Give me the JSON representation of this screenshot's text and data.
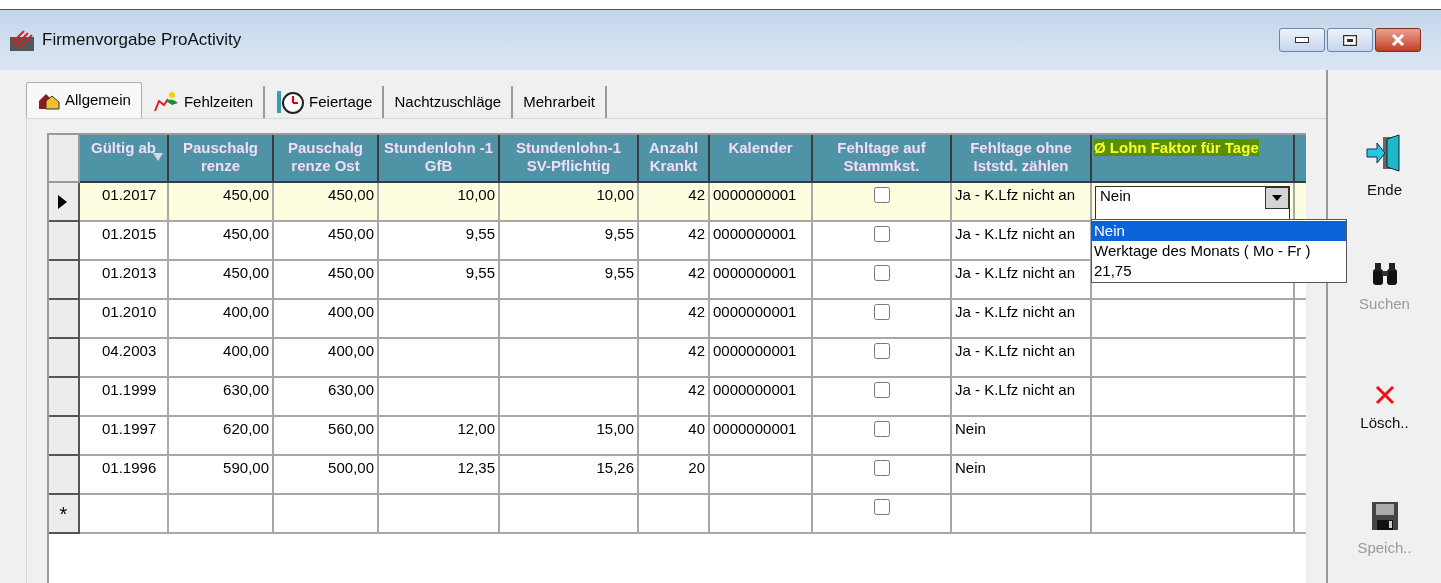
{
  "window": {
    "title": "Firmenvorgabe ProActivity"
  },
  "tabs": [
    {
      "label": "Allgemein",
      "selected": true
    },
    {
      "label": "Fehlzeiten",
      "selected": false
    },
    {
      "label": "Feiertage",
      "selected": false
    },
    {
      "label": "Nachtzuschläge",
      "selected": false
    },
    {
      "label": "Mehrarbeit",
      "selected": false
    }
  ],
  "grid": {
    "columns": [
      {
        "label": "Gültig ab",
        "sorted": true,
        "highlighted": false
      },
      {
        "label": "Pauschalg renze",
        "sorted": false,
        "highlighted": false
      },
      {
        "label": "Pauschalg renze Ost",
        "sorted": false,
        "highlighted": false
      },
      {
        "label": "Stundenlohn -1 GfB",
        "sorted": false,
        "highlighted": false
      },
      {
        "label": "Stundenlohn-1 SV-Pflichtig",
        "sorted": false,
        "highlighted": false
      },
      {
        "label": "Anzahl Krankt",
        "sorted": false,
        "highlighted": false
      },
      {
        "label": "Kalender",
        "sorted": false,
        "highlighted": false
      },
      {
        "label": "Fehltage auf Stammkst.",
        "sorted": false,
        "highlighted": false
      },
      {
        "label": "Fehltage ohne Iststd. zählen",
        "sorted": false,
        "highlighted": false
      },
      {
        "label": "Ø Lohn Faktor für Tage",
        "sorted": false,
        "highlighted": true
      }
    ],
    "rows": [
      {
        "current": true,
        "values": {
          "gueltig_ab": "01.2017",
          "pauschalgrenze": "450,00",
          "pauschalgrenze_ost": "450,00",
          "stundenlohn_gfb": "10,00",
          "stundenlohn_sv": "10,00",
          "anzahl_krankt": "42",
          "kalender": "0000000001"
        },
        "checked": false,
        "fehltage": "Ja - K.Lfz nicht an",
        "editor": {
          "value": "Nein",
          "expanded": true,
          "options": [
            {
              "label": "Nein",
              "selected": true
            },
            {
              "label": "Werktage des Monats ( Mo - Fr )",
              "selected": false
            },
            {
              "label": "21,75",
              "selected": false
            }
          ]
        }
      },
      {
        "current": false,
        "values": {
          "gueltig_ab": "01.2015",
          "pauschalgrenze": "450,00",
          "pauschalgrenze_ost": "450,00",
          "stundenlohn_gfb": "9,55",
          "stundenlohn_sv": "9,55",
          "anzahl_krankt": "42",
          "kalender": "0000000001"
        },
        "checked": false,
        "fehltage": "Ja - K.Lfz nicht an"
      },
      {
        "current": false,
        "values": {
          "gueltig_ab": "01.2013",
          "pauschalgrenze": "450,00",
          "pauschalgrenze_ost": "450,00",
          "stundenlohn_gfb": "9,55",
          "stundenlohn_sv": "9,55",
          "anzahl_krankt": "42",
          "kalender": "0000000001"
        },
        "checked": false,
        "fehltage": "Ja - K.Lfz nicht an"
      },
      {
        "current": false,
        "values": {
          "gueltig_ab": "01.2010",
          "pauschalgrenze": "400,00",
          "pauschalgrenze_ost": "400,00",
          "anzahl_krankt": "42",
          "kalender": "0000000001"
        },
        "checked": false,
        "fehltage": "Ja - K.Lfz nicht an"
      },
      {
        "current": false,
        "values": {
          "gueltig_ab": "04.2003",
          "pauschalgrenze": "400,00",
          "pauschalgrenze_ost": "400,00",
          "anzahl_krankt": "42",
          "kalender": "0000000001"
        },
        "checked": false,
        "fehltage": "Ja - K.Lfz nicht an"
      },
      {
        "current": false,
        "values": {
          "gueltig_ab": "01.1999",
          "pauschalgrenze": "630,00",
          "pauschalgrenze_ost": "630,00",
          "anzahl_krankt": "42",
          "kalender": "0000000001"
        },
        "checked": false,
        "fehltage": "Ja - K.Lfz nicht an"
      },
      {
        "current": false,
        "values": {
          "gueltig_ab": "01.1997",
          "pauschalgrenze": "620,00",
          "pauschalgrenze_ost": "560,00",
          "stundenlohn_gfb": "12,00",
          "stundenlohn_sv": "15,00",
          "anzahl_krankt": "40",
          "kalender": "0000000001"
        },
        "checked": false,
        "fehltage": "Nein"
      },
      {
        "current": false,
        "values": {
          "gueltig_ab": "01.1996",
          "pauschalgrenze": "590,00",
          "pauschalgrenze_ost": "500,00",
          "stundenlohn_gfb": "12,35",
          "stundenlohn_sv": "15,26",
          "anzahl_krankt": "20"
        },
        "checked": false,
        "fehltage": "Nein"
      }
    ],
    "new_row": {
      "marker": "*",
      "checked": false
    }
  },
  "actions": [
    {
      "label": "Ende",
      "disabled": false
    },
    {
      "label": "Suchen",
      "disabled": true
    },
    {
      "label": "Lösch..",
      "disabled": false
    },
    {
      "label": "Speich..",
      "disabled": true
    }
  ]
}
